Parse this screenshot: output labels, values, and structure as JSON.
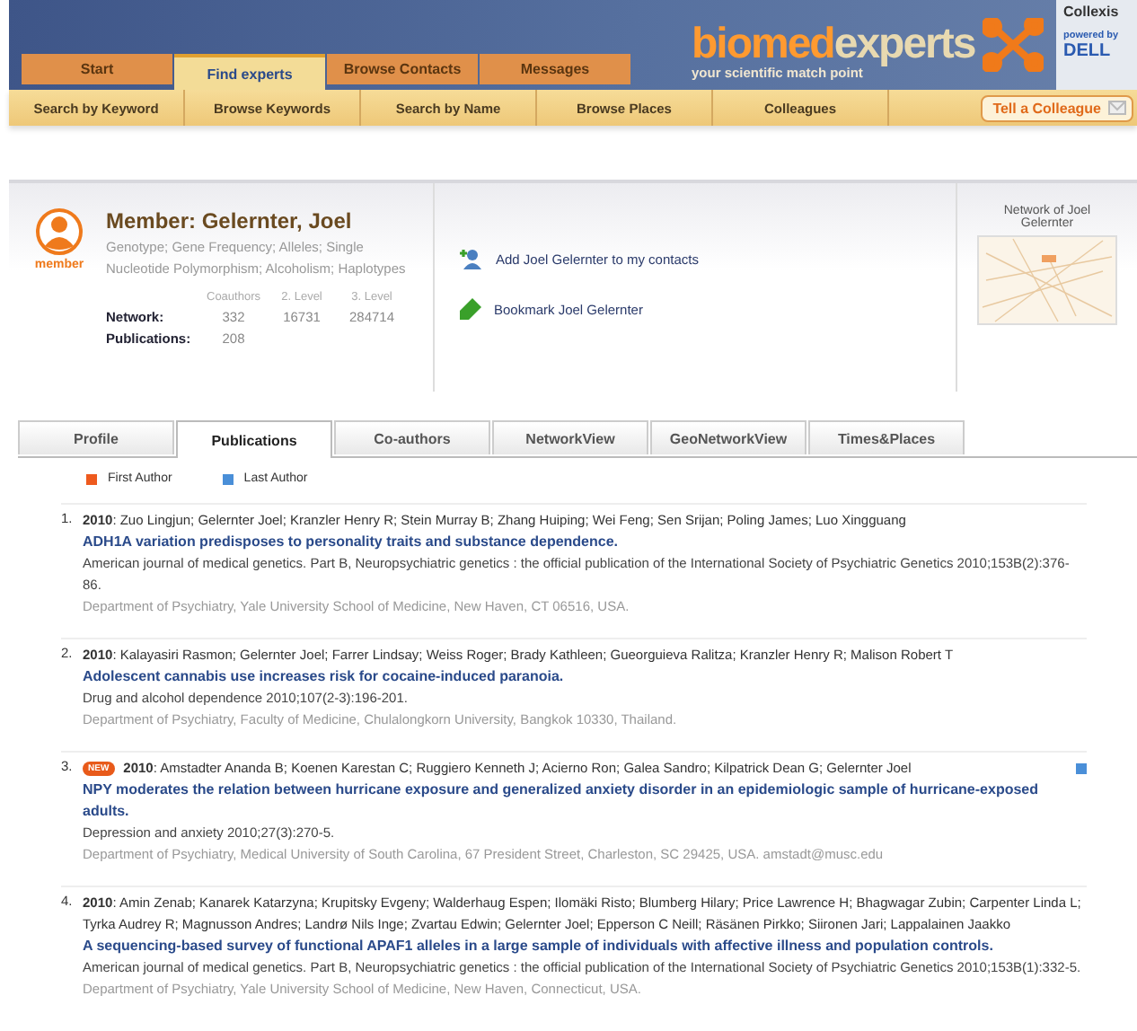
{
  "header": {
    "logo_primary": "biomed",
    "logo_secondary": "experts",
    "tagline": "your scientific match point",
    "partner": {
      "name": "Collexis",
      "powered_by": "powered by",
      "brand": "DELL"
    }
  },
  "main_tabs": [
    {
      "label": "Start",
      "selected": false
    },
    {
      "label": "Find experts",
      "selected": true
    },
    {
      "label": "Browse Contacts",
      "selected": false
    },
    {
      "label": "Messages",
      "selected": false
    }
  ],
  "sub_nav": [
    "Search by Keyword",
    "Browse Keywords",
    "Search by Name",
    "Browse Places",
    "Colleagues"
  ],
  "tell_colleague": "Tell a Colleague",
  "member": {
    "badge": "member",
    "name": "Member: Gelernter, Joel",
    "keywords": "Genotype;  Gene Frequency;  Alleles;  Single Nucleotide Polymorphism;  Alcoholism;  Haplotypes",
    "stat_columns": [
      "Coauthors",
      "2. Level",
      "3. Level"
    ],
    "stats": [
      {
        "label": "Network:",
        "values": [
          "332",
          "16731",
          "284714"
        ]
      },
      {
        "label": "Publications:",
        "values": [
          "208"
        ]
      }
    ],
    "actions": [
      {
        "kind": "add",
        "label": "Add Joel Gelernter to my contacts"
      },
      {
        "kind": "bookmark",
        "label": "Bookmark Joel Gelernter"
      }
    ],
    "network_title": "Network of Joel Gelernter"
  },
  "profile_tabs": [
    {
      "label": "Profile",
      "selected": false
    },
    {
      "label": "Publications",
      "selected": true
    },
    {
      "label": "Co-authors",
      "selected": false
    },
    {
      "label": "NetworkView",
      "selected": false
    },
    {
      "label": "GeoNetworkView",
      "selected": false
    },
    {
      "label": "Times&Places",
      "selected": false
    }
  ],
  "legend": [
    {
      "label": "First Author",
      "color": "#ee5a1e"
    },
    {
      "label": "Last Author",
      "color": "#4a8fd8"
    }
  ],
  "publications": [
    {
      "number": "1.",
      "year": "2010",
      "authors": ": Zuo Lingjun; Gelernter Joel; Kranzler Henry R; Stein Murray B; Zhang Huiping; Wei Feng; Sen Srijan; Poling James; Luo Xingguang",
      "last_author": false,
      "title": "ADH1A variation predisposes to personality traits and substance dependence.",
      "journal": "American journal of medical genetics. Part B, Neuropsychiatric genetics : the official publication of the International Society of Psychiatric Genetics 2010;153B(2):376-86.",
      "affiliation": "Department of Psychiatry, Yale University School of Medicine, New Haven, CT 06516, USA."
    },
    {
      "number": "2.",
      "year": "2010",
      "authors": ": Kalayasiri Rasmon; Gelernter Joel; Farrer Lindsay; Weiss Roger; Brady Kathleen; Gueorguieva Ralitza; Kranzler Henry R; Malison Robert T",
      "last_author": false,
      "title": "Adolescent cannabis use increases risk for cocaine-induced paranoia.",
      "journal": "Drug and alcohol dependence 2010;107(2-3):196-201.",
      "affiliation": "Department of Psychiatry, Faculty of Medicine, Chulalongkorn University, Bangkok 10330, Thailand."
    },
    {
      "number": "3.",
      "new_badge": "NEW",
      "year": "2010",
      "authors": ": Amstadter Ananda B; Koenen Karestan C; Ruggiero Kenneth J; Acierno Ron; Galea Sandro; Kilpatrick Dean G; Gelernter Joel",
      "last_author": true,
      "title": "NPY moderates the relation between hurricane exposure and generalized anxiety disorder in an epidemiologic sample of hurricane-exposed adults.",
      "journal": "Depression and anxiety 2010;27(3):270-5.",
      "affiliation": "Department of Psychiatry, Medical University of South Carolina, 67 President Street, Charleston, SC 29425, USA. amstadt@musc.edu"
    },
    {
      "number": "4.",
      "year": "2010",
      "authors": ": Amin Zenab; Kanarek Katarzyna; Krupitsky Evgeny; Walderhaug Espen; Ilomäki Risto; Blumberg Hilary; Price Lawrence H; Bhagwagar Zubin; Carpenter Linda L; Tyrka Audrey R; Magnusson Andres; Landrø Nils Inge; Zvartau Edwin; Gelernter Joel; Epperson C Neill; Räsänen Pirkko; Siironen Jari; Lappalainen Jaakko",
      "last_author": false,
      "title": "A sequencing-based survey of functional APAF1 alleles in a large sample of individuals with affective illness and population controls.",
      "journal": "American journal of medical genetics. Part B, Neuropsychiatric genetics : the official publication of the International Society of Psychiatric Genetics 2010;153B(1):332-5.",
      "affiliation": "Department of Psychiatry, Yale University School of Medicine, New Haven, Connecticut, USA."
    }
  ]
}
